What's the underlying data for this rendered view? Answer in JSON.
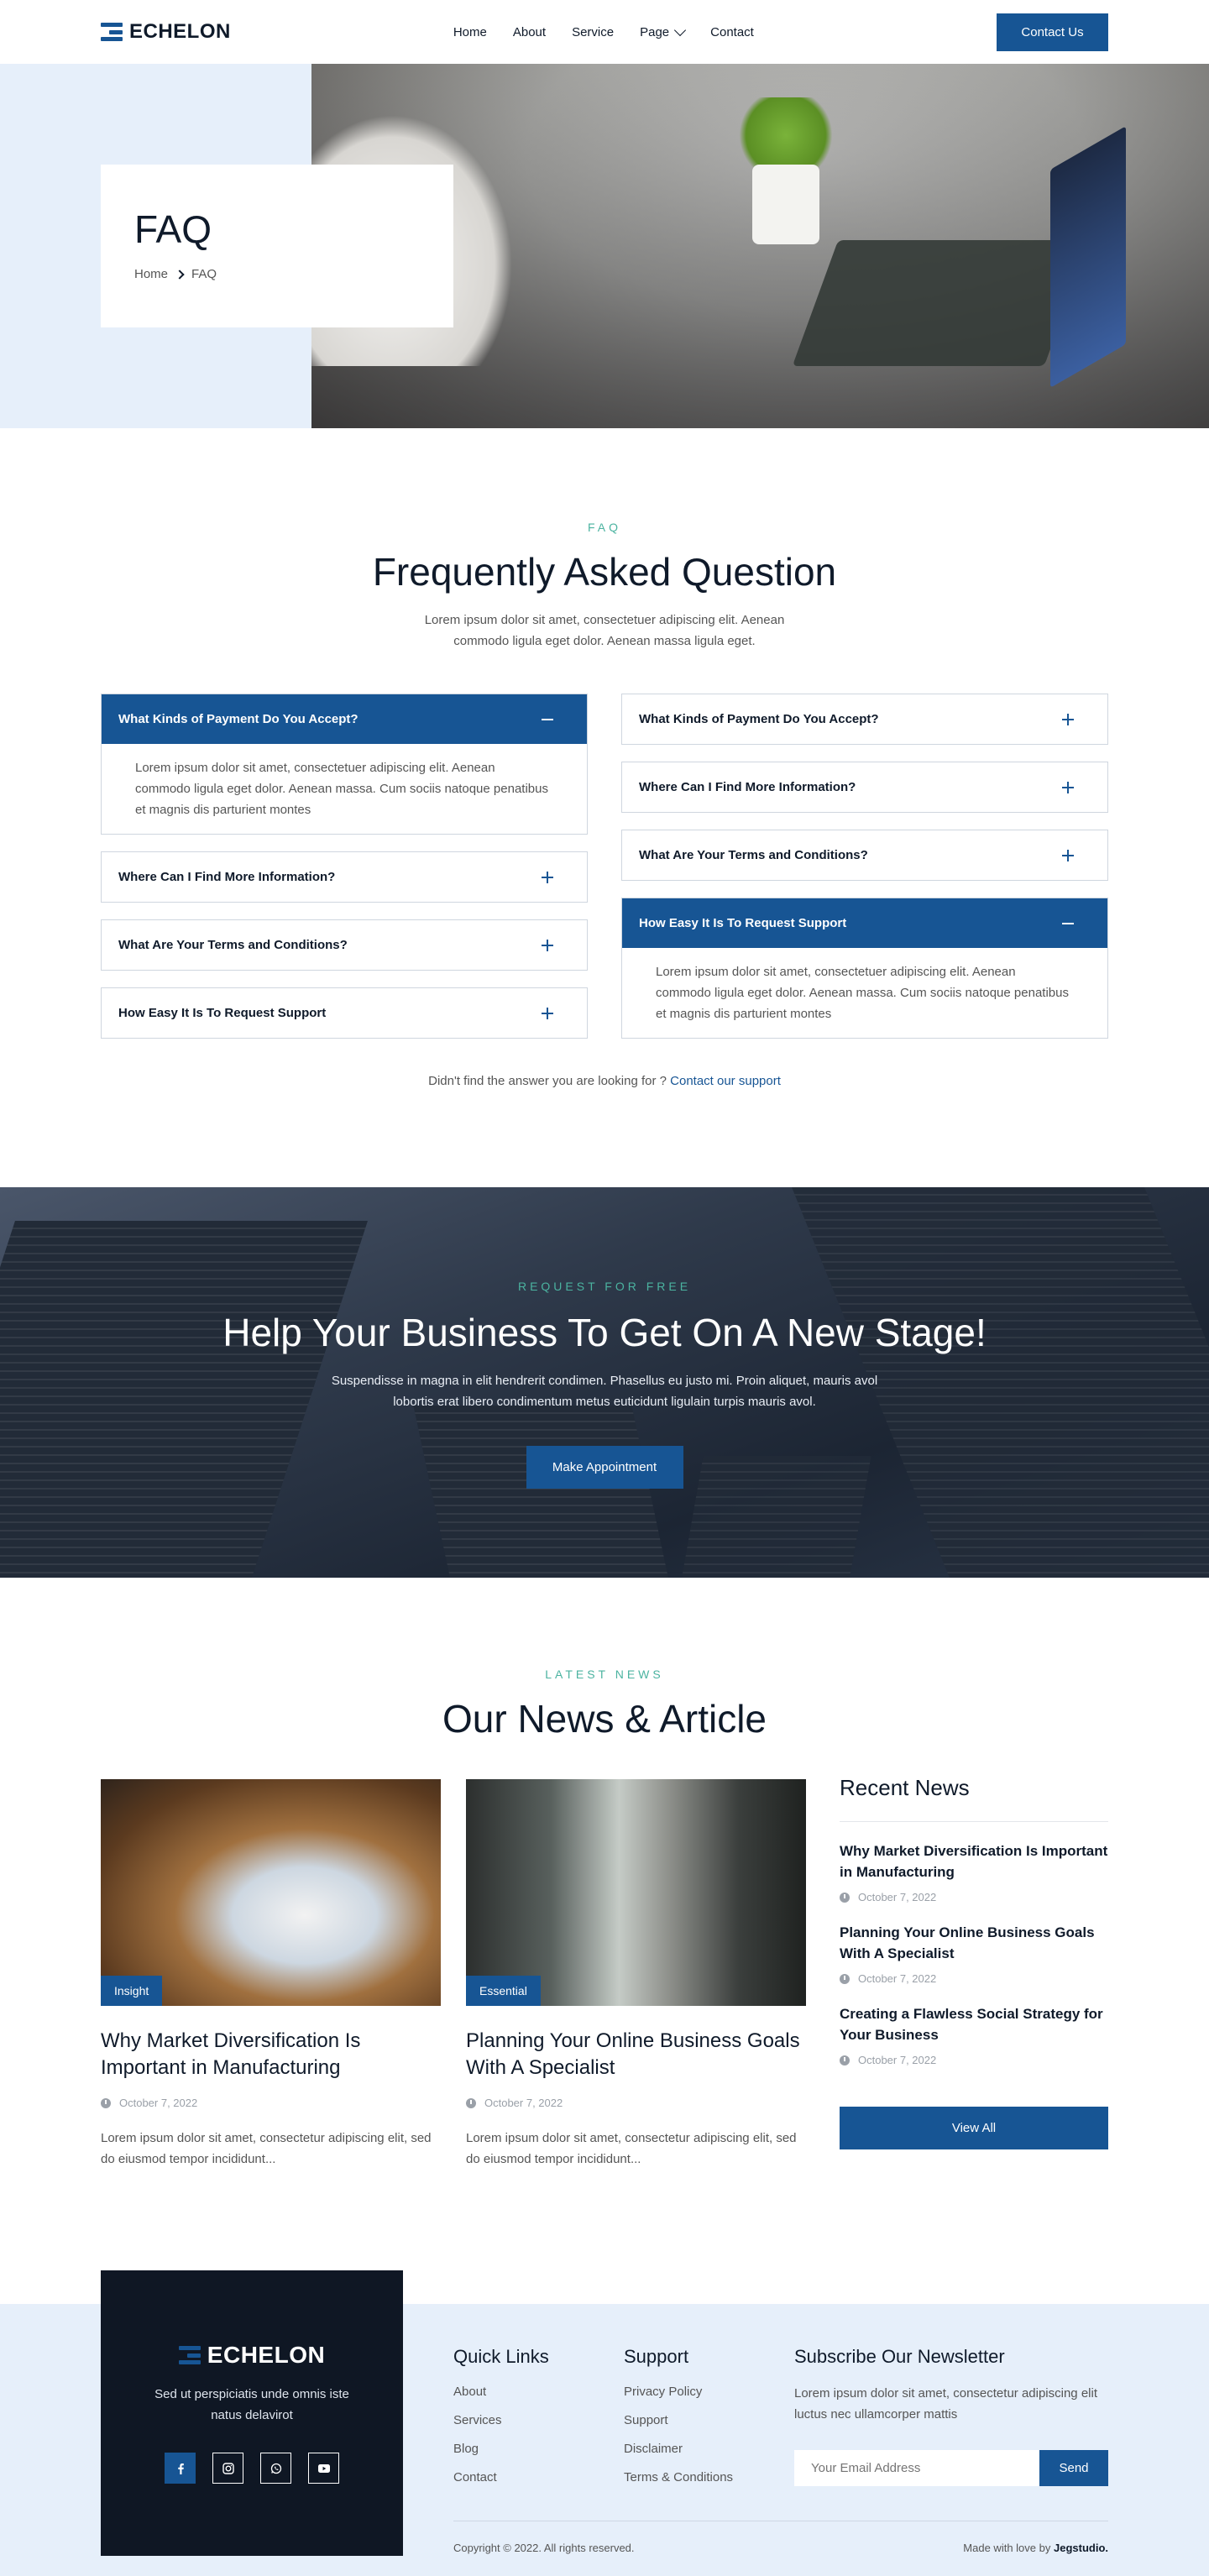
{
  "brand": {
    "name": "ECHELON"
  },
  "nav": {
    "items": [
      "Home",
      "About",
      "Service",
      "Page",
      "Contact"
    ],
    "cta": "Contact Us"
  },
  "hero": {
    "title": "FAQ",
    "breadcrumb": [
      "Home",
      "FAQ"
    ]
  },
  "faq": {
    "eyebrow": "FAQ",
    "title": "Frequently Asked Question",
    "subtitle": "Lorem ipsum dolor sit amet, consectetuer adipiscing elit. Aenean commodo ligula eget dolor. Aenean massa ligula eget.",
    "left": [
      {
        "q": "What Kinds of Payment Do You Accept?",
        "a": "Lorem ipsum dolor sit amet, consectetuer adipiscing elit. Aenean commodo ligula eget dolor. Aenean massa. Cum sociis natoque penatibus et magnis dis parturient montes"
      },
      {
        "q": "Where Can I Find More Information?"
      },
      {
        "q": "What Are Your Terms and Conditions?"
      },
      {
        "q": "How Easy It Is To Request Support"
      }
    ],
    "right": [
      {
        "q": "What Kinds of Payment Do You Accept?"
      },
      {
        "q": "Where Can I Find More Information?"
      },
      {
        "q": "What Are Your Terms and Conditions?"
      },
      {
        "q": "How Easy It Is To Request Support",
        "a": "Lorem ipsum dolor sit amet, consectetuer adipiscing elit. Aenean commodo ligula eget dolor. Aenean massa. Cum sociis natoque penatibus et magnis dis parturient montes"
      }
    ],
    "footer_text": "Didn't find the answer you are looking for ?",
    "footer_link": "Contact our support"
  },
  "cta": {
    "eyebrow": "REQUEST FOR FREE",
    "title": "Help Your Business To Get On A New Stage!",
    "subtitle": "Suspendisse in magna in elit hendrerit condimen. Phasellus eu justo mi. Proin aliquet, mauris avol lobortis erat libero condimentum metus euticidunt ligulain turpis mauris avol.",
    "button": "Make Appointment"
  },
  "news": {
    "eyebrow": "LATEST NEWS",
    "title": "Our News & Article",
    "cards": [
      {
        "badge": "Insight",
        "title": "Why Market Diversification Is Important in Manufacturing",
        "date": "October 7, 2022",
        "excerpt": "Lorem ipsum dolor sit amet, consectetur adipiscing elit, sed do eiusmod tempor incididunt..."
      },
      {
        "badge": "Essential",
        "title": "Planning Your Online Business Goals With A Specialist",
        "date": "October 7, 2022",
        "excerpt": "Lorem ipsum dolor sit amet, consectetur adipiscing elit, sed do eiusmod tempor incididunt..."
      }
    ],
    "recent_title": "Recent News",
    "recent": [
      {
        "title": "Why Market Diversification Is Important in Manufacturing",
        "date": "October 7, 2022"
      },
      {
        "title": "Planning Your Online Business Goals With A Specialist",
        "date": "October 7, 2022"
      },
      {
        "title": "Creating a Flawless Social Strategy for Your Business",
        "date": "October 7, 2022"
      }
    ],
    "view_all": "View All"
  },
  "footer": {
    "tagline": "Sed ut perspiciatis unde omnis iste natus delavirot",
    "socials": [
      "facebook-icon",
      "instagram-icon",
      "whatsapp-icon",
      "youtube-icon"
    ],
    "quick_links_title": "Quick Links",
    "quick_links": [
      "About",
      "Services",
      "Blog",
      "Contact"
    ],
    "support_title": "Support",
    "support": [
      "Privacy Policy",
      "Support",
      "Disclaimer",
      "Terms & Conditions"
    ],
    "newsletter_title": "Subscribe Our Newsletter",
    "newsletter_text": "Lorem ipsum dolor sit amet, consectetur adipiscing elit luctus nec ullamcorper mattis",
    "email_placeholder": "Your Email Address",
    "send": "Send",
    "copyright": "Copyright © 2022. All rights reserved.",
    "made_by_prefix": "Made with love by",
    "made_by": "Jegstudio."
  },
  "colors": {
    "primary": "#175594",
    "accent": "#4bb3a0",
    "dark": "#0f1724",
    "light": "#e6effa"
  }
}
